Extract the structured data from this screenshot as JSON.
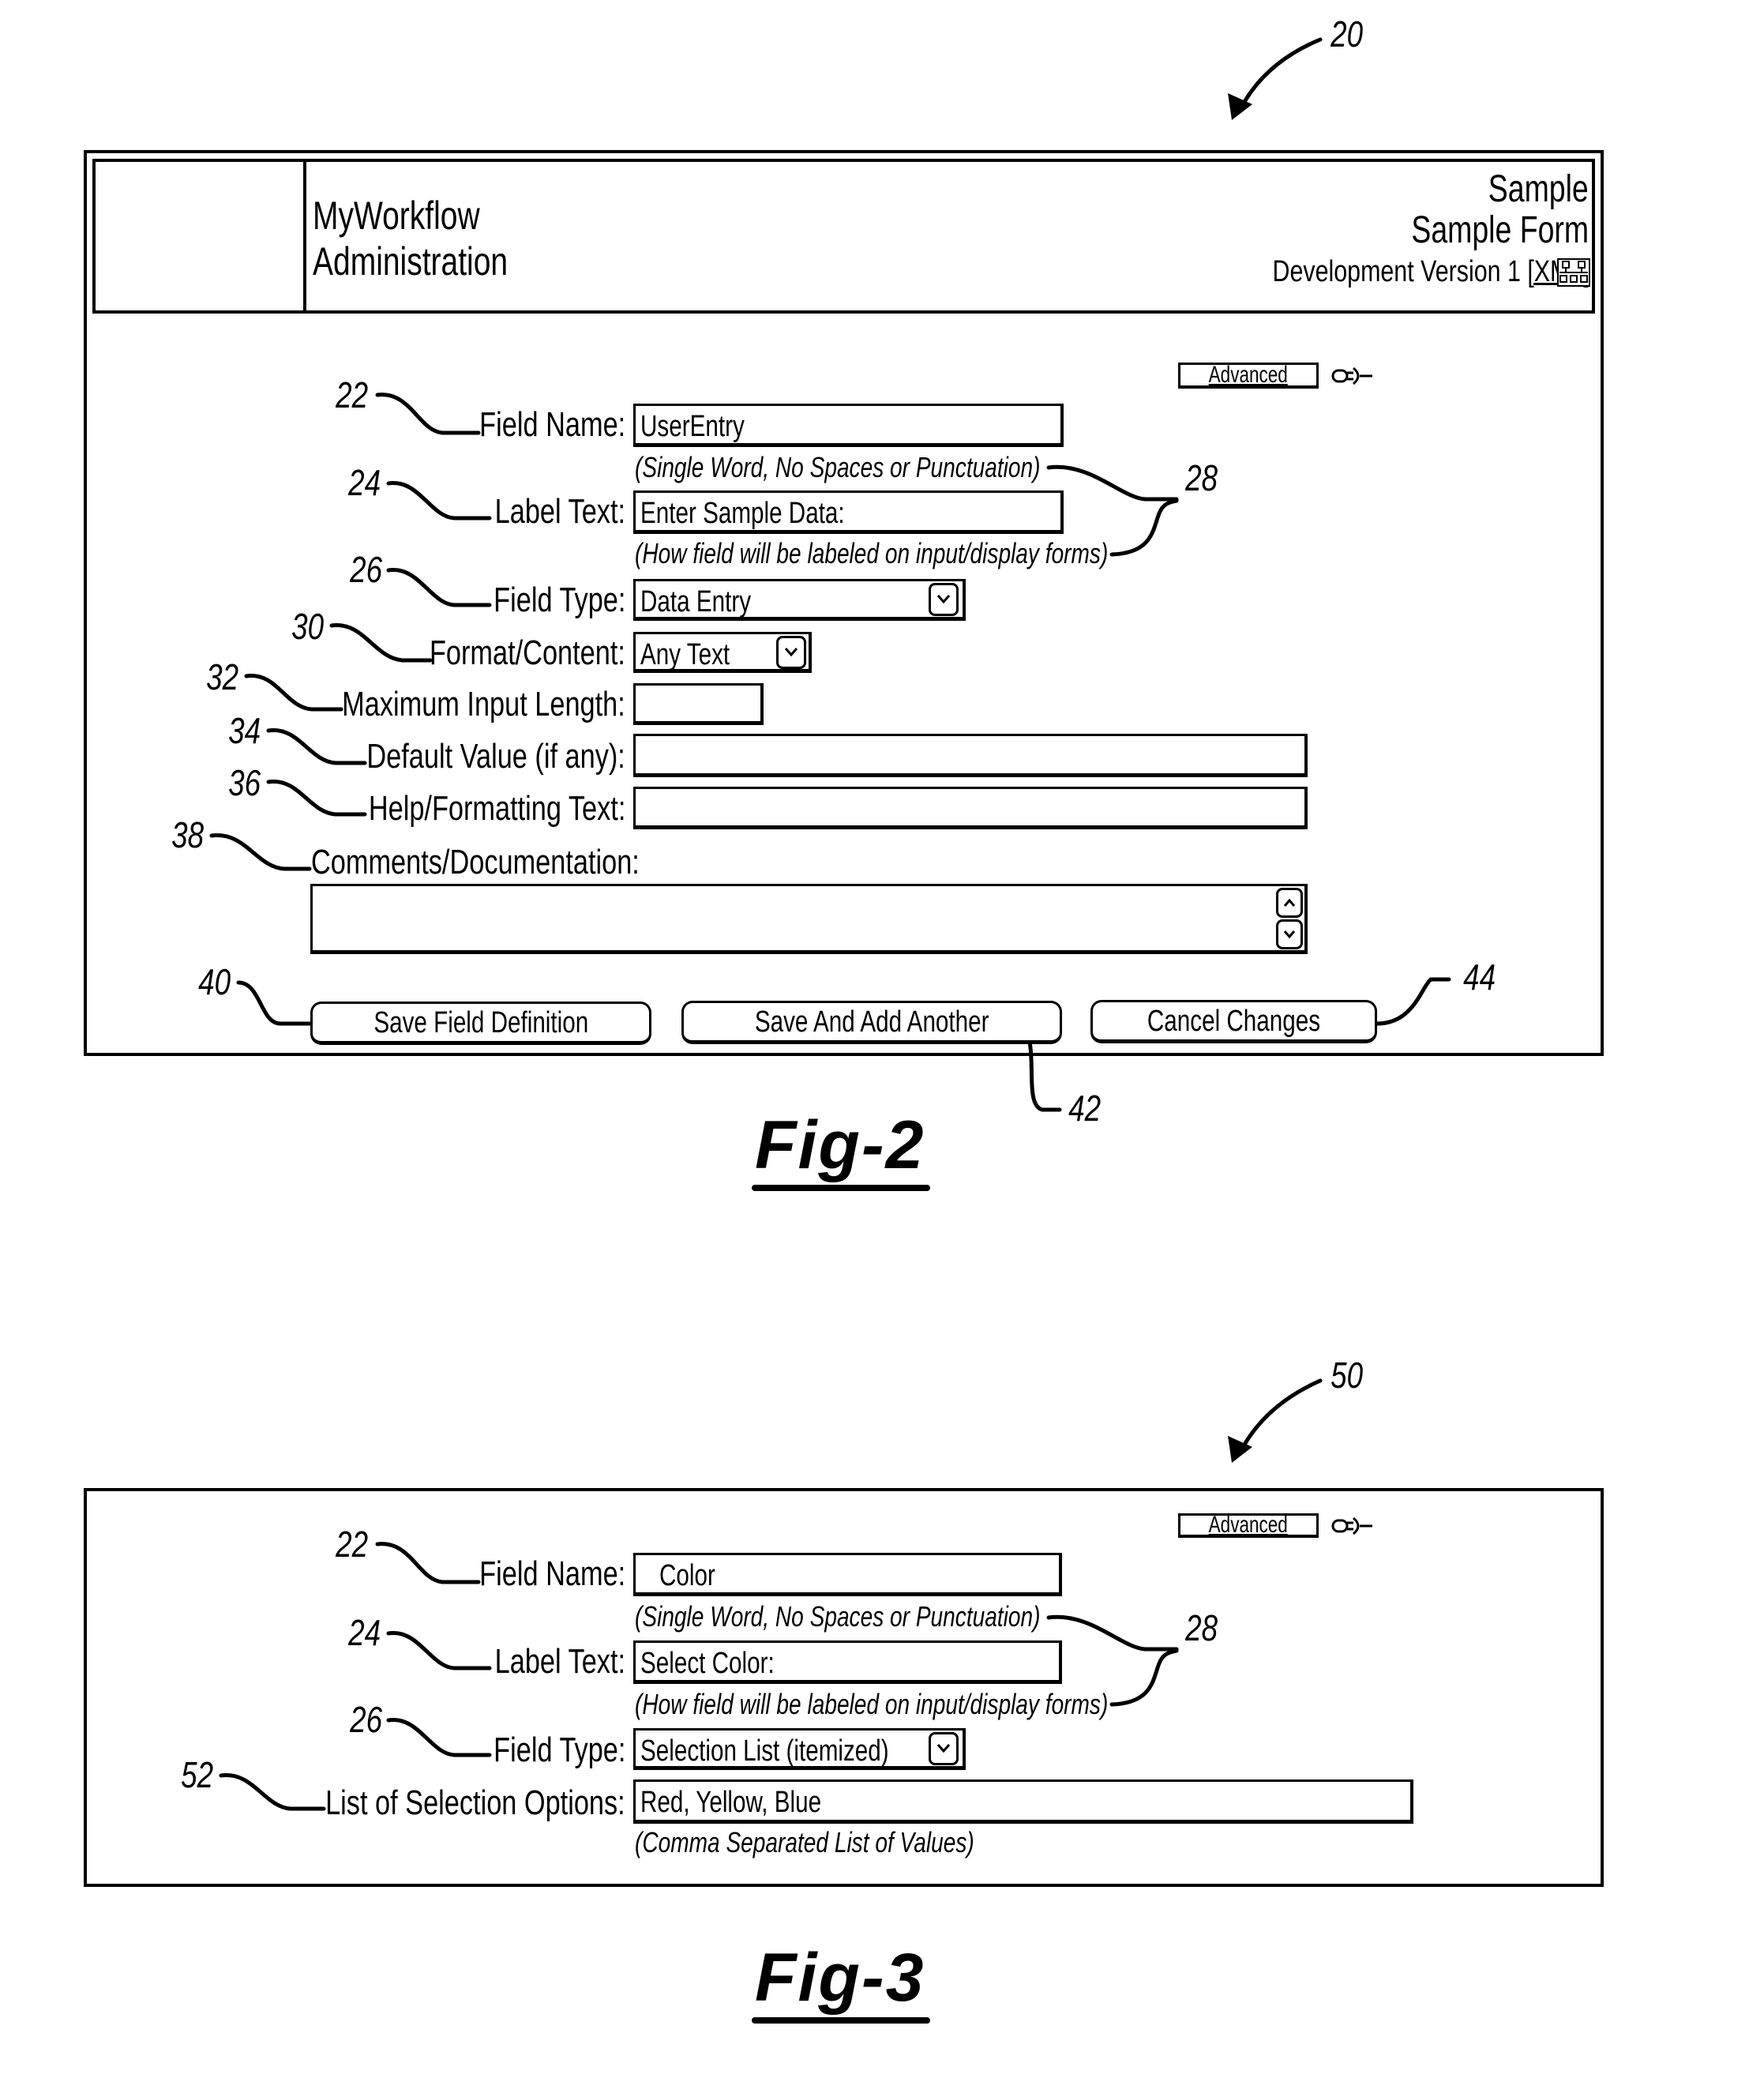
{
  "figures": {
    "fig2": {
      "caption": "Fig-2",
      "reference_number": "20",
      "header": {
        "app_title_line1": "MyWorkflow",
        "app_title_line2": "Administration",
        "context_line1": "Sample",
        "context_line2": "Sample Form",
        "version_text": "Development Version 1",
        "xml_link": "[XML]",
        "hierarchy_icon": "org-chart-icon"
      },
      "advanced_button": {
        "label": "Advanced",
        "icon": "pushpin-icon"
      },
      "fields": {
        "field_name": {
          "label": "Field Name:",
          "value": "UserEntry",
          "hint": "(Single Word, No Spaces or Punctuation)",
          "ref": "22"
        },
        "label_text": {
          "label": "Label Text:",
          "value": "Enter Sample Data:",
          "hint": "(How field will be labeled on input/display forms)",
          "ref": "24"
        },
        "field_type": {
          "label": "Field Type:",
          "value": "Data Entry",
          "ref": "26"
        },
        "format_content": {
          "label": "Format/Content:",
          "value": "Any Text",
          "ref": "30"
        },
        "max_input_length": {
          "label": "Maximum Input Length:",
          "value": "",
          "ref": "32"
        },
        "default_value": {
          "label": "Default Value (if any):",
          "value": "",
          "ref": "34"
        },
        "help_text": {
          "label": "Help/Formatting Text:",
          "value": "",
          "ref": "36"
        },
        "comments": {
          "label": "Comments/Documentation:",
          "value": "",
          "ref": "38"
        }
      },
      "hints_ref": "28",
      "buttons": {
        "save_field": {
          "label": "Save Field Definition",
          "ref": "40"
        },
        "save_add": {
          "label": "Save And Add Another",
          "ref": "42"
        },
        "cancel": {
          "label": "Cancel Changes",
          "ref": "44"
        }
      }
    },
    "fig3": {
      "caption": "Fig-3",
      "reference_number": "50",
      "advanced_button": {
        "label": "Advanced",
        "icon": "pushpin-icon"
      },
      "fields": {
        "field_name": {
          "label": "Field Name:",
          "value": "Color",
          "hint": "(Single Word, No Spaces or Punctuation)",
          "ref": "22"
        },
        "label_text": {
          "label": "Label Text:",
          "value": "Select Color:",
          "hint": "(How field will be labeled on input/display forms)",
          "ref": "24"
        },
        "field_type": {
          "label": "Field Type:",
          "value": "Selection List (itemized)",
          "ref": "26"
        },
        "selection_options": {
          "label": "List of Selection Options:",
          "value": "Red, Yellow, Blue",
          "hint": "(Comma Separated List of Values)",
          "ref": "52"
        }
      },
      "hints_ref": "28"
    }
  }
}
